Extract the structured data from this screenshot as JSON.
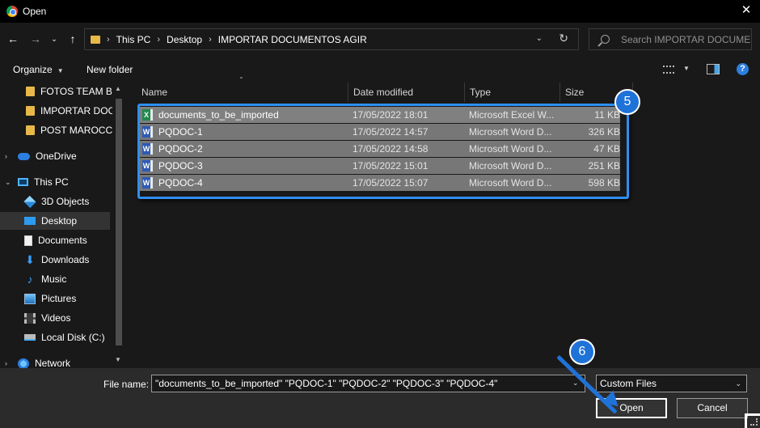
{
  "window": {
    "title": "Open",
    "close": "✕"
  },
  "nav": {
    "back": "←",
    "forward": "→",
    "recent": "⌄",
    "up": "↑",
    "breadcrumbs": [
      "This PC",
      "Desktop",
      "IMPORTAR DOCUMENTOS AGIR"
    ],
    "separator": "›",
    "dropdown": "⌄",
    "refresh": "↻"
  },
  "search": {
    "placeholder": "Search IMPORTAR DOCUME..."
  },
  "toolbar": {
    "organize": "Organize",
    "organize_arrow": "▼",
    "new_folder": "New folder",
    "view_arrow": "▼",
    "help": "?"
  },
  "sidebar": {
    "items": [
      {
        "label": "FOTOS TEAM BU",
        "icon": "folder-icon"
      },
      {
        "label": "IMPORTAR DOCU",
        "icon": "folder-icon"
      },
      {
        "label": "POST MAROCCO",
        "icon": "folder-icon"
      },
      {
        "label": "OneDrive",
        "icon": "onedrive-icon"
      },
      {
        "label": "This PC",
        "icon": "this-pc-icon"
      },
      {
        "label": "3D Objects",
        "icon": "3d-objects-icon"
      },
      {
        "label": "Desktop",
        "icon": "desktop-icon"
      },
      {
        "label": "Documents",
        "icon": "documents-icon"
      },
      {
        "label": "Downloads",
        "icon": "downloads-icon"
      },
      {
        "label": "Music",
        "icon": "music-icon"
      },
      {
        "label": "Pictures",
        "icon": "pictures-icon"
      },
      {
        "label": "Videos",
        "icon": "videos-icon"
      },
      {
        "label": "Local Disk (C:)",
        "icon": "local-disk-icon"
      },
      {
        "label": "Network",
        "icon": "network-icon"
      }
    ],
    "selected": "Desktop"
  },
  "columns": {
    "name": "Name",
    "date": "Date modified",
    "type": "Type",
    "size": "Size"
  },
  "files": [
    {
      "name": "documents_to_be_imported",
      "date": "17/05/2022 18:01",
      "type": "Microsoft Excel W...",
      "size": "11 KB",
      "kind": "excel"
    },
    {
      "name": "PQDOC-1",
      "date": "17/05/2022 14:57",
      "type": "Microsoft Word D...",
      "size": "326 KB",
      "kind": "word"
    },
    {
      "name": "PQDOC-2",
      "date": "17/05/2022 14:58",
      "type": "Microsoft Word D...",
      "size": "47 KB",
      "kind": "word"
    },
    {
      "name": "PQDOC-3",
      "date": "17/05/2022 15:01",
      "type": "Microsoft Word D...",
      "size": "251 KB",
      "kind": "word"
    },
    {
      "name": "PQDOC-4",
      "date": "17/05/2022 15:07",
      "type": "Microsoft Word D...",
      "size": "598 KB",
      "kind": "word"
    }
  ],
  "bottom": {
    "file_name_label": "File name:",
    "file_name_value": "\"documents_to_be_imported\" \"PQDOC-1\" \"PQDOC-2\" \"PQDOC-3\" \"PQDOC-4\"",
    "file_type": "Custom Files",
    "open": "Open",
    "cancel": "Cancel"
  },
  "annotations": {
    "step_select": "5",
    "step_open": "6"
  },
  "colors": {
    "accent": "#1f72d8",
    "selection": "#777777",
    "folder": "#e8b948"
  }
}
